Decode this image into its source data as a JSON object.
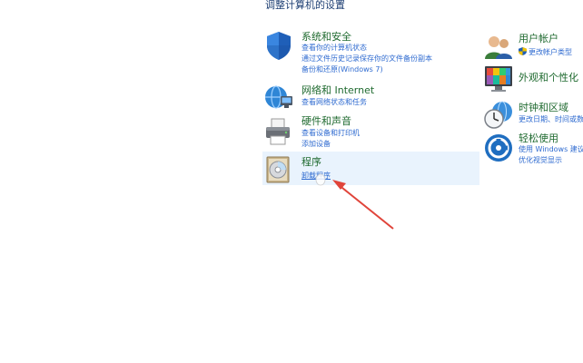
{
  "heading": "调整计算机的设置",
  "left_categories": [
    {
      "title": "系统和安全",
      "links": [
        "查看你的计算机状态",
        "通过文件历史记录保存你的文件备份副本",
        "备份和还原(Windows 7)"
      ],
      "icon": "shield-icon"
    },
    {
      "title": "网络和 Internet",
      "links": [
        "查看网络状态和任务"
      ],
      "icon": "network-globe-icon"
    },
    {
      "title": "硬件和声音",
      "links": [
        "查看设备和打印机",
        "添加设备"
      ],
      "icon": "printer-icon"
    },
    {
      "title": "程序",
      "links": [
        "卸载程序"
      ],
      "icon": "programs-disc-icon"
    }
  ],
  "right_categories": [
    {
      "title": "用户帐户",
      "links": [
        "更改帐户类型"
      ],
      "icon": "users-icon"
    },
    {
      "title": "外观和个性化",
      "links": [],
      "icon": "appearance-monitor-icon"
    },
    {
      "title": "时钟和区域",
      "links": [
        "更改日期、时间或数字格式"
      ],
      "icon": "clock-globe-icon"
    },
    {
      "title": "轻松使用",
      "links": [
        "使用 Windows 建议的设置",
        "优化视觉显示"
      ],
      "icon": "ease-of-access-icon"
    }
  ],
  "colors": {
    "title": "#1f6a2f",
    "link": "#2f6bd0",
    "highlight": "#e9f3fd",
    "arrow": "#e0443a"
  }
}
